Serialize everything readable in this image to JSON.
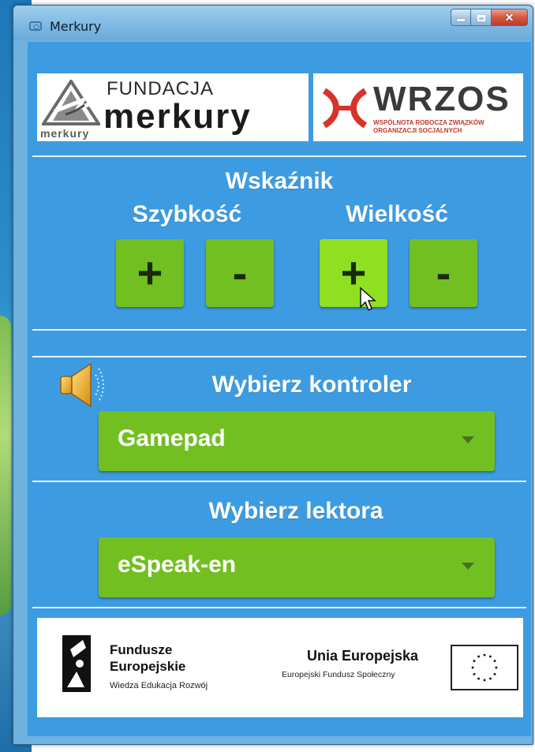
{
  "window": {
    "title": "Merkury"
  },
  "header": {
    "merkury_logo_small": "merkury",
    "merkury_logo_fundacja": "FUNDACJA",
    "merkury_logo_name": "merkury",
    "wrzos_name": "WRZOS",
    "wrzos_sub": "WSPÓLNOTA ROBOCZA ZWIĄZKÓW ORGANIZACJI SOCJALNYCH"
  },
  "pointer": {
    "heading": "Wskaźnik",
    "speed": {
      "label": "Szybkość",
      "plus": "+",
      "minus": "-"
    },
    "size": {
      "label": "Wielkość",
      "plus": "+",
      "minus": "-"
    }
  },
  "controller": {
    "heading": "Wybierz kontroler",
    "selected": "Gamepad"
  },
  "reader": {
    "heading": "Wybierz lektora",
    "selected": "eSpeak-en"
  },
  "footer": {
    "fe_title_1": "Fundusze",
    "fe_title_2": "Europejskie",
    "fe_sub": "Wiedza Edukacja Rozwój",
    "ue_title": "Unia Europejska",
    "ue_sub": "Europejski Fundusz Społeczny"
  },
  "colors": {
    "panel_background": "#3d9ce1",
    "button_green": "#72bf22",
    "button_green_hover": "#8fe021",
    "divider": "#e6f2fb"
  },
  "icons": [
    "app-icon",
    "minimize-icon",
    "maximize-icon",
    "close-icon",
    "speaker-icon",
    "mouse-cursor-icon",
    "dropdown-arrow-icon",
    "eu-flag-icon"
  ]
}
